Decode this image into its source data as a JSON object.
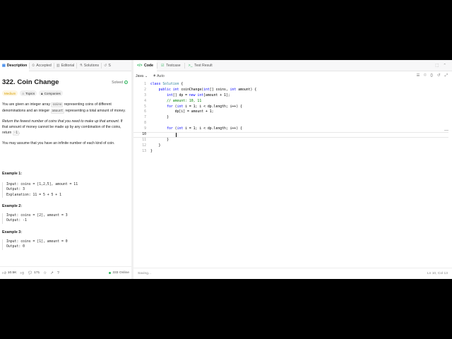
{
  "left": {
    "tabs": [
      {
        "icon": "▤",
        "label": "Description"
      },
      {
        "icon": "⏲",
        "label": "Accepted"
      },
      {
        "icon": "▥",
        "label": "Editorial"
      },
      {
        "icon": "⚗",
        "label": "Solutions"
      },
      {
        "icon": "↺",
        "label": "S"
      }
    ],
    "title": "322. Coin Change",
    "solved_label": "Solved",
    "badges": {
      "difficulty": "Medium",
      "topics": "Topics",
      "companies": "Companies"
    },
    "desc": {
      "p1_a": "You are given an integer array ",
      "p1_code1": "coins",
      "p1_b": " representing coins of different denominations and an integer ",
      "p1_code2": "amount",
      "p1_c": " representing a total amount of money.",
      "p2_a": "Return the fewest number of coins that you need to make up that amount",
      "p2_b": ". If that amount of money cannot be made up by any combination of the coins, return ",
      "p2_code": "-1",
      "p2_c": ".",
      "p3": "You may assume that you have an infinite number of each kind of coin."
    },
    "examples": [
      {
        "title": "Example 1:",
        "lines": [
          "Input: coins = [1,2,5], amount = 11",
          "Output: 3",
          "Explanation: 11 = 5 + 5 + 1"
        ]
      },
      {
        "title": "Example 2:",
        "lines": [
          "Input: coins = [2], amount = 3",
          "Output: -1"
        ]
      },
      {
        "title": "Example 3:",
        "lines": [
          "Input: coins = [1], amount = 0",
          "Output: 0"
        ]
      }
    ],
    "footer": {
      "likes": "10.5K",
      "comments": "171",
      "online": "333 Online"
    }
  },
  "right": {
    "tabs": {
      "code": "Code",
      "testcase": "Testcase",
      "result": "Test Result"
    },
    "toolbar": {
      "language": "Java",
      "auto": "Auto"
    },
    "line_numbers": [
      "1",
      "2",
      "3",
      "4",
      "5",
      "6",
      "7",
      "8",
      "9",
      "10",
      "11",
      "12",
      "13"
    ],
    "current_line": 10,
    "footer": {
      "status": "Saving...",
      "position": "Ln 10, Col 13"
    }
  },
  "colors": {
    "accent": "#1a73e8",
    "success": "#2db55d",
    "medium": "#d9a000",
    "keyword": "#0000ff",
    "comment": "#008000"
  }
}
